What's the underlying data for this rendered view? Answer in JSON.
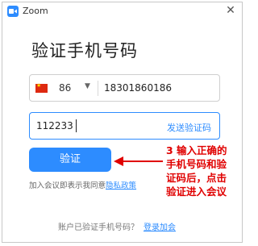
{
  "window": {
    "title": "Zoom"
  },
  "heading": "验证手机号码",
  "phone": {
    "country_code": "86",
    "number": "18301860186"
  },
  "verification": {
    "code": "112233",
    "send_code_label": "发送验证码"
  },
  "verify_button": "验证",
  "hint": {
    "prefix": "加入会议即表示我同意",
    "privacy_link": "隐私政策"
  },
  "annotation": "3 输入正确的手机号码和验证码后，点击验证进入会议",
  "footer": {
    "text": "账户已验证手机号码？",
    "login_link": "登录加会"
  },
  "colors": {
    "accent": "#2d8cff",
    "annotation": "#e00000"
  }
}
